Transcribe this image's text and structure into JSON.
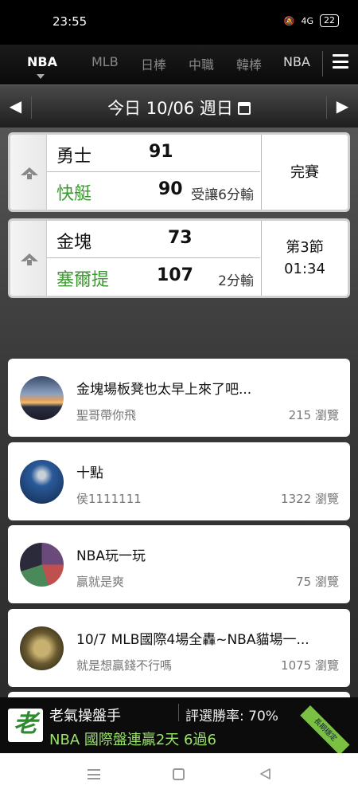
{
  "status_bar": {
    "time": "23:55",
    "signal_text": "4G",
    "battery": "22"
  },
  "tabs": [
    {
      "label": "NBA",
      "active": true
    },
    {
      "label": "MLB",
      "active": false
    },
    {
      "label": "日棒",
      "active": false
    },
    {
      "label": "中職",
      "active": false
    },
    {
      "label": "韓棒",
      "active": false
    },
    {
      "label": "NBA",
      "active": false
    }
  ],
  "date_nav": {
    "prev": "◀",
    "label": "今日 10/06 週日",
    "next": "▶"
  },
  "games": [
    {
      "home": {
        "name": "勇士",
        "score": "91"
      },
      "away": {
        "name": "快艇",
        "score": "90",
        "note": "受讓6分輸"
      },
      "status_line1": "完賽",
      "status_line2": ""
    },
    {
      "home": {
        "name": "金塊",
        "score": "73"
      },
      "away": {
        "name": "塞爾提",
        "score": "107",
        "note": "2分輸"
      },
      "status_line1": "第3節",
      "status_line2": "01:34"
    }
  ],
  "posts": [
    {
      "title": "金塊場板凳也太早上來了吧...",
      "author": "聖哥帶你飛",
      "views": "215 瀏覽"
    },
    {
      "title": "十點",
      "author": "侯1111111",
      "views": "1322 瀏覽"
    },
    {
      "title": "NBA玩一玩",
      "author": "贏就是爽",
      "views": "75 瀏覽"
    },
    {
      "title": "10/7 MLB國際4場全轟~NBA貓場一...",
      "author": "就是想贏錢不行嗎",
      "views": "1075 瀏覽"
    }
  ],
  "ad": {
    "logo": "老",
    "name": "老氣操盤手",
    "rate": "評選勝率: 70%",
    "line": "NBA 國際盤連贏2天 6過6",
    "ribbon": "長期穩定"
  },
  "colors": {
    "green_team": "#3a9a2e",
    "ad_green": "#9be36a"
  }
}
